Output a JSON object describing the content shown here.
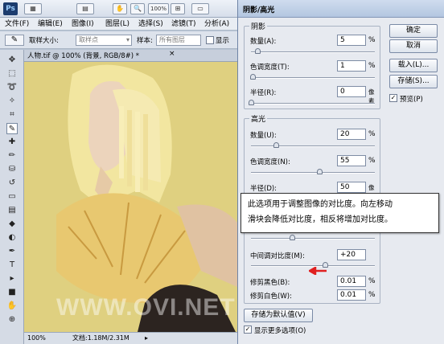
{
  "ps": {
    "logo": "Ps",
    "zoom_readout": "100%",
    "menus": [
      "文件(F)",
      "编辑(E)",
      "图像(I)",
      "图层(L)",
      "选择(S)",
      "滤镜(T)",
      "分析(A)"
    ],
    "options": {
      "sample_size_label": "取样大小:",
      "sample_size_value": "取样点",
      "sample_label": "样本:",
      "sample_value": "所有图层",
      "show_ring_label": "显示"
    },
    "doc_tab": "人物.tif @ 100% (背景, RGB/8#) *",
    "status": {
      "zoom": "100%",
      "doc": "文档:1.18M/2.31M"
    },
    "tool_icons": [
      "move",
      "marquee",
      "lasso",
      "quick-select",
      "crop",
      "eyedropper",
      "healing",
      "brush",
      "stamp",
      "history-brush",
      "eraser",
      "gradient",
      "blur",
      "dodge",
      "pen",
      "type",
      "path-select",
      "shape",
      "hand",
      "zoom"
    ],
    "watermark": "WWW.OVI.NET"
  },
  "dialog": {
    "title": "阴影/高光",
    "shadows": {
      "legend": "阴影",
      "amount": {
        "label": "数量(A):",
        "value": "5",
        "unit": "%",
        "level": 0.05
      },
      "tonal_width": {
        "label": "色调宽度(T):",
        "value": "1",
        "unit": "%",
        "level": 0.01
      },
      "radius": {
        "label": "半径(R):",
        "value": "0",
        "unit": "像素",
        "level": 0.0
      }
    },
    "highlights": {
      "legend": "高光",
      "amount": {
        "label": "数量(U):",
        "value": "20",
        "unit": "%",
        "level": 0.2
      },
      "tonal_width": {
        "label": "色调宽度(N):",
        "value": "55",
        "unit": "%",
        "level": 0.55
      },
      "radius": {
        "label": "半径(D):",
        "value": "50",
        "unit": "像素",
        "level": 0.2
      }
    },
    "adjustments": {
      "midtone_contrast": {
        "label": "中间调对比度(M):",
        "value": "+20",
        "level": 0.6
      },
      "clip_black": {
        "label": "修剪黑色(B):",
        "value": "0.01",
        "unit": "%"
      },
      "clip_white": {
        "label": "修剪白色(W):",
        "value": "0.01",
        "unit": "%"
      }
    },
    "buttons": {
      "ok": "确定",
      "cancel": "取消",
      "load": "载入(L)...",
      "save": "存储(S)...",
      "save_default": "存储为默认值(V)"
    },
    "preview": {
      "label": "预览(P)",
      "checked": true
    },
    "more_options": {
      "label": "显示更多选项(O)",
      "checked": true
    }
  },
  "tooltip": {
    "line1": "此选项用于调整图像的对比度。向左移动",
    "line2": "滑块会降低对比度，相反将增加对比度。"
  },
  "colors": {
    "canvas_bg": "#dfd080",
    "hair": "#f2e6a0",
    "skin": "#ecd4bc",
    "arrow": "#e02020"
  }
}
